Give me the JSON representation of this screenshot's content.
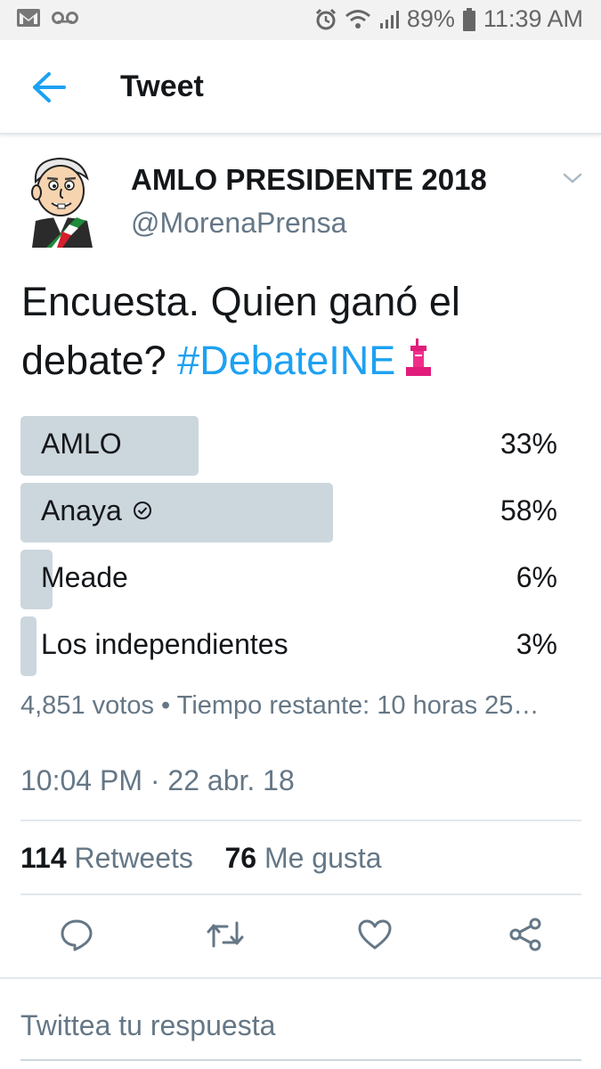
{
  "status_bar": {
    "battery": "89%",
    "time": "11:39 AM",
    "icons": [
      "gmail-icon",
      "voicemail-icon",
      "alarm-icon",
      "wifi-icon",
      "signal-icon",
      "battery-icon"
    ]
  },
  "app_bar": {
    "title": "Tweet",
    "back_icon": "arrow-left-icon"
  },
  "tweet": {
    "display_name": "AMLO PRESIDENTE 2018",
    "handle": "@MorenaPrensa",
    "text": "Encuesta.  Quien ganó el debate? ",
    "hashtag": "#DebateINE",
    "emoji": "podium-icon"
  },
  "poll": {
    "options": [
      {
        "label": "AMLO",
        "percent_text": "33%",
        "fraction": 0.33
      },
      {
        "label": "Anaya",
        "percent_text": "58%",
        "fraction": 0.58,
        "selected": true
      },
      {
        "label": "Meade",
        "percent_text": "6%",
        "fraction": 0.06
      },
      {
        "label": "Los independientes",
        "percent_text": "3%",
        "fraction": 0.03
      }
    ],
    "meta": "4,851 votos • Tiempo restante: 10 horas 25…"
  },
  "timestamp": "10:04 PM · 22 abr. 18",
  "stats": {
    "retweets_count": "114",
    "retweets_label": "Retweets",
    "likes_count": "76",
    "likes_label": "Me gusta"
  },
  "actions": [
    "reply-icon",
    "retweet-icon",
    "like-icon",
    "share-icon"
  ],
  "reply": {
    "placeholder": "Twittea tu respuesta"
  },
  "colors": {
    "accent": "#1da1f2",
    "poll_bar": "#ccd6dd",
    "secondary_text": "#657786"
  }
}
